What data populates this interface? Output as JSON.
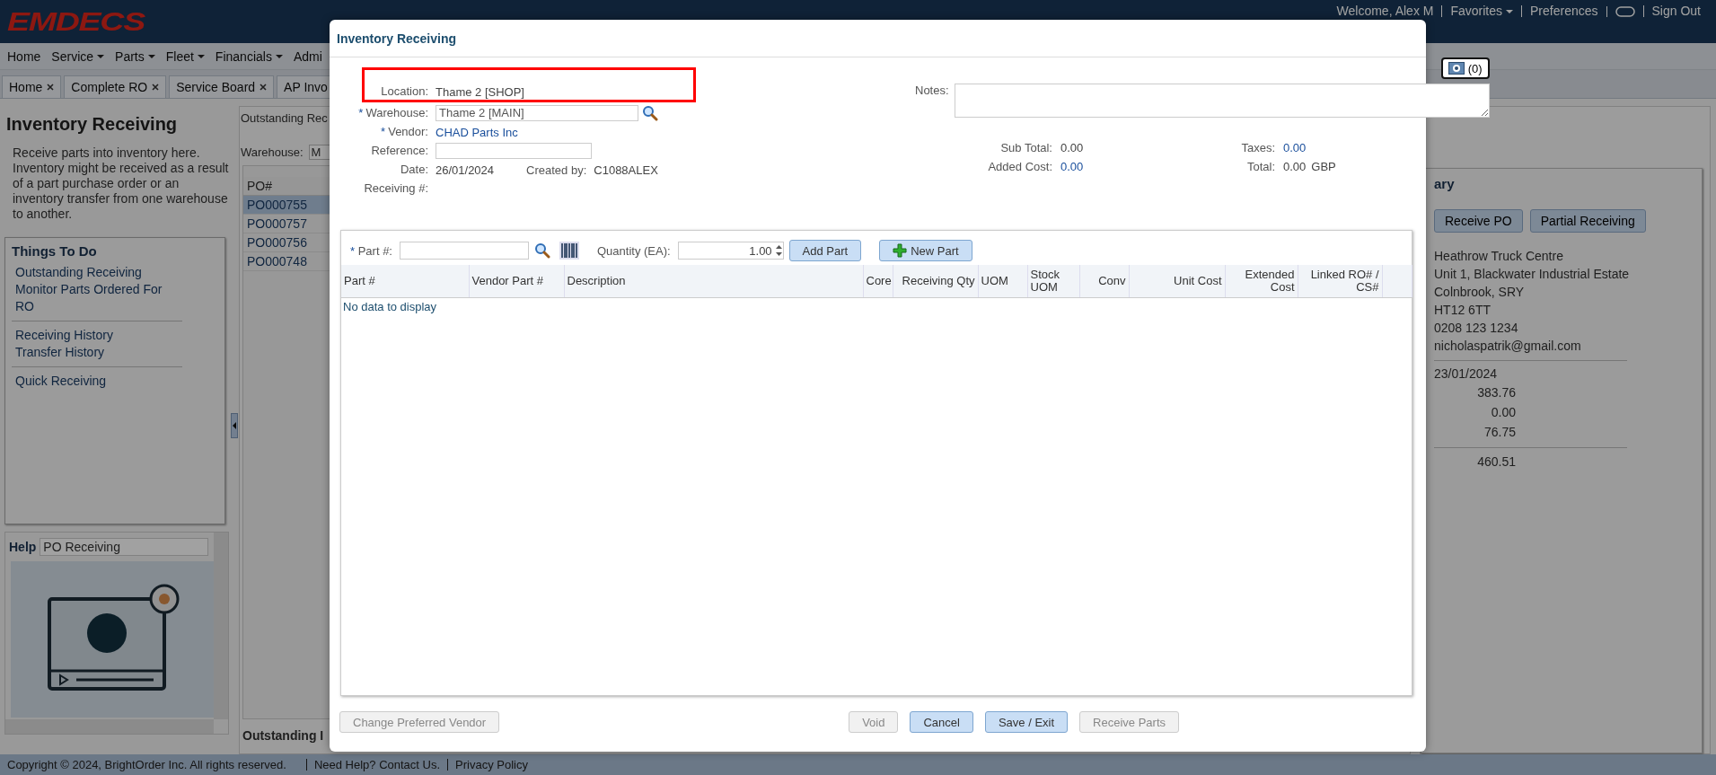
{
  "header": {
    "logo": "EMDECS",
    "user_links": [
      {
        "kind": "text",
        "label": "Welcome, Alex M"
      },
      {
        "kind": "menu",
        "label": "Favorites"
      },
      {
        "kind": "link",
        "label": "Preferences"
      },
      {
        "kind": "icon"
      },
      {
        "kind": "link",
        "label": "Sign Out"
      }
    ]
  },
  "menu": [
    {
      "label": "Home",
      "dropdown": false
    },
    {
      "label": "Service",
      "dropdown": true
    },
    {
      "label": "Parts",
      "dropdown": true
    },
    {
      "label": "Fleet",
      "dropdown": true
    },
    {
      "label": "Financials",
      "dropdown": true
    },
    {
      "label": "Admi",
      "dropdown": false
    }
  ],
  "tabs": [
    {
      "label": "Home",
      "selected": false,
      "closable": true
    },
    {
      "label": "Complete RO",
      "selected": false,
      "closable": true
    },
    {
      "label": "Service Board",
      "selected": false,
      "closable": true
    },
    {
      "label": "AP Invo",
      "selected": false,
      "closable": false
    }
  ],
  "sidebar": {
    "title": "Inventory Receiving",
    "description": "Receive parts into inventory here. Inventory might be received as a result of a part purchase order or an inventory transfer from one warehouse to another.",
    "things_to_do": {
      "title": "Things To Do",
      "groups": [
        [
          "Outstanding Receiving",
          "Monitor Parts Ordered For RO"
        ],
        [
          "Receiving History",
          "Transfer History"
        ],
        [
          "Quick Receiving"
        ]
      ]
    },
    "help": {
      "title": "Help",
      "topic": "PO Receiving"
    }
  },
  "outstanding": {
    "title": "Outstanding Rec",
    "warehouse_label": "Warehouse:",
    "warehouse_value": "M",
    "column": "PO#",
    "rows": [
      {
        "po": "PO000755",
        "selected": true
      },
      {
        "po": "PO000757",
        "selected": false
      },
      {
        "po": "PO000756",
        "selected": false
      },
      {
        "po": "PO000748",
        "selected": false
      }
    ],
    "footer_title": "Outstanding I"
  },
  "summary": {
    "title": "ary",
    "buttons": [
      "Receive PO",
      "Partial Receiving"
    ],
    "address": [
      "Heathrow Truck Centre",
      "Unit 1, Blackwater Industrial Estate",
      "Colnbrook, SRY",
      "HT12 6TT",
      "0208 123 1234",
      "nicholaspatrik@gmail.com"
    ],
    "date": "23/01/2024",
    "amounts": [
      "383.76",
      "0.00",
      "76.75"
    ],
    "total": "460.51"
  },
  "footer": {
    "copyright": "Copyright © 2024, BrightOrder Inc. All rights reserved.",
    "links": [
      "Need Help? Contact Us.",
      "Privacy Policy"
    ]
  },
  "dialog": {
    "title": "Inventory Receiving",
    "attachments": "(0)",
    "fields": [
      {
        "kind": "text",
        "label": "Location:",
        "required": false,
        "value": "Thame 2 [SHOP]"
      },
      {
        "kind": "lookup",
        "label": "Warehouse:",
        "required": true,
        "value": "Thame 2 [MAIN]"
      },
      {
        "kind": "link",
        "label": "Vendor:",
        "required": true,
        "value": "CHAD Parts Inc"
      },
      {
        "kind": "input",
        "label": "Reference:",
        "required": false
      },
      {
        "kind": "date",
        "label": "Date:",
        "required": false,
        "value": "26/01/2024",
        "extra_label": "Created by:",
        "extra_value": "C1088ALEX"
      },
      {
        "kind": "text",
        "label": "Receiving #:",
        "required": false
      }
    ],
    "required_mark": "*",
    "notes_label": "Notes:",
    "totals": [
      {
        "label": "Sub Total:",
        "value": "0.00",
        "link": false
      },
      {
        "label": "Taxes:",
        "value": "0.00",
        "link": true
      },
      {
        "label": "Added Cost:",
        "value": "0.00",
        "link": true
      },
      {
        "label": "Total:",
        "value": "0.00",
        "link": false,
        "currency": "GBP"
      }
    ],
    "part_entry": {
      "label": "Part #:",
      "quantity_label": "Quantity (EA):",
      "quantity": "1.00",
      "add_button": "Add Part",
      "new_button": "New Part"
    },
    "columns": [
      "Part #",
      "Vendor Part #",
      "Description",
      "Core",
      "Receiving Qty",
      "UOM",
      "Stock UOM",
      "Conv",
      "Unit Cost",
      "Extended Cost",
      "Linked RO# / CS#"
    ],
    "empty_text": "No data to display",
    "left_buttons": [
      {
        "label": "Change Preferred Vendor",
        "disabled": true
      }
    ],
    "right_buttons": [
      {
        "label": "Void",
        "disabled": true
      },
      {
        "label": "Cancel",
        "disabled": false
      },
      {
        "label": "Save / Exit",
        "disabled": false
      },
      {
        "label": "Receive Parts",
        "disabled": true
      }
    ]
  }
}
